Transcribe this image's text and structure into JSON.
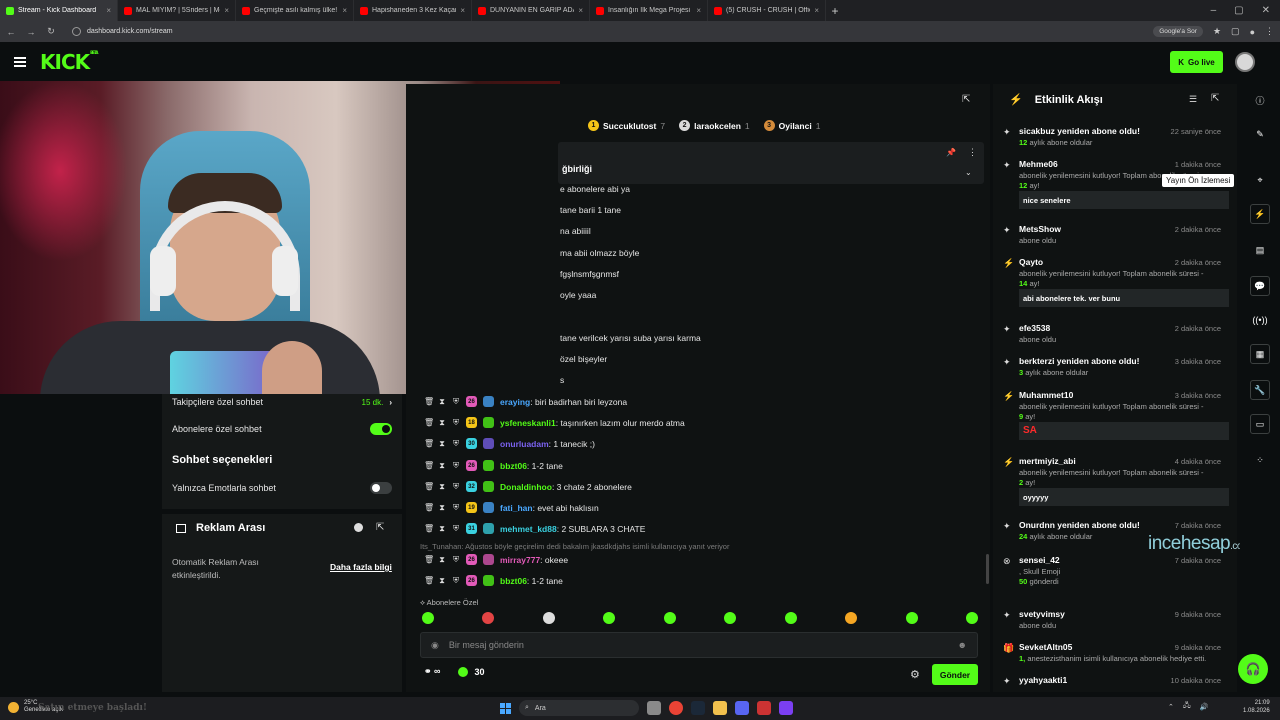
{
  "browser": {
    "tabs": [
      {
        "title": "Stream - Kick Dashboard",
        "active": true,
        "color": "#53fc18"
      },
      {
        "title": "MAL MIYIM? | 5Sriders | Motosi",
        "active": false,
        "color": "#ff0000"
      },
      {
        "title": "Geçmişte asılı kalmış ülke! Kübal",
        "active": false,
        "color": "#ff0000"
      },
      {
        "title": "Hapishaneden 3 Kez Kaçan Adam",
        "active": false,
        "color": "#ff0000"
      },
      {
        "title": "DÜNYANIN EN GARİP ADASINI",
        "active": false,
        "color": "#ff0000"
      },
      {
        "title": "İnsanlığın İlk Mega Projesi Göb",
        "active": false,
        "color": "#ff0000"
      },
      {
        "title": "(5) CRUSH - CRUSH | Official M",
        "active": false,
        "color": "#ff0000"
      }
    ],
    "url": "dashboard.kick.com/stream",
    "google_pill": "Google'a Sor"
  },
  "header": {
    "logo": "KICK",
    "logo_badge": "BETA",
    "go_live_label": "Go live"
  },
  "settings": {
    "follower_chat_label": "Takipçilere özel sohbet",
    "follower_chat_value": "15 dk.",
    "sub_chat_label": "Abonelere özel sohbet",
    "chat_options_title": "Sohbet seçenekleri",
    "emote_chat_label": "Yalnızca Emotlarla sohbet"
  },
  "ad_break": {
    "title": "Reklam Arası",
    "text": "Otomatik Reklam Arası etkinleştirildi.",
    "link": "Daha fazla bilgi"
  },
  "chat": {
    "top_gifters": [
      {
        "rank": "1",
        "name": "Succuklutost",
        "count": "7",
        "color": "#f5c518"
      },
      {
        "rank": "2",
        "name": "laraokcelen",
        "count": "1",
        "color": "#d9d9d9"
      },
      {
        "rank": "3",
        "name": "Oyilanci",
        "count": "1",
        "color": "#d48b3a"
      }
    ],
    "pinned_title": "ğbirliği",
    "hidden_messages": [
      "e abonelere abi ya",
      "tane barii 1 tane",
      "na abiiiil",
      "ma abii olmazz böyle",
      "fgşlnsmfşgnmsf",
      "oyle yaaa",
      "tane verilcek yarısı suba yarısı karma",
      "özel bişeyler",
      "s"
    ],
    "messages": [
      {
        "badge": "26",
        "badge_color": "#e25ab8",
        "user": "eraying",
        "user_color": "#4aa8ff",
        "text": "biri badirhan biri leyzona"
      },
      {
        "badge": "18",
        "badge_color": "#f5c518",
        "user": "ysfeneskanli1",
        "user_color": "#53fc18",
        "text": "taşınırken lazım olur merdo atma"
      },
      {
        "badge": "30",
        "badge_color": "#3ad1e0",
        "user": "onurluadam",
        "user_color": "#7b62f0",
        "text": "1 tanecik ;)"
      },
      {
        "badge": "26",
        "badge_color": "#e25ab8",
        "user": "bbzt06",
        "user_color": "#53fc18",
        "text": "1-2 tane"
      },
      {
        "badge": "32",
        "badge_color": "#3ad1e0",
        "user": "Donaldinhoo",
        "user_color": "#53fc18",
        "text": "3 chate 2 abonelere"
      },
      {
        "badge": "19",
        "badge_color": "#f5c518",
        "user": "fati_han",
        "user_color": "#4aa8ff",
        "text": "evet abi haklısın"
      },
      {
        "badge": "31",
        "badge_color": "#3ad1e0",
        "user": "mehmet_kd88",
        "user_color": "#3ad1e0",
        "text": "2 SUBLARA 3 CHATE"
      },
      {
        "badge": "26",
        "badge_color": "#e25ab8",
        "user": "mirray777",
        "user_color": "#e25ab8",
        "text": "okeee"
      },
      {
        "badge": "26",
        "badge_color": "#e25ab8",
        "user": "bbzt06",
        "user_color": "#53fc18",
        "text": "1-2 tane"
      }
    ],
    "reply_hint": "Its_Tunahan: Ağustos böyle geçirelim dedi bakalım jkasdkdjahs isimli kullanıcıya yanıt veriyor",
    "sub_only_label": "Abonelere Özel",
    "input_placeholder": "Bir mesaj gönderin",
    "points": "30",
    "send_label": "Gönder"
  },
  "feed": {
    "title": "Etkinlik Akışı",
    "tooltip": "Yayın Ön İzlemesi",
    "items": [
      {
        "name": "sicakbuz yeniden abone oldu!",
        "time": "22 saniye önce",
        "sub_num": "12",
        "sub_text": "aylık abone oldular"
      },
      {
        "name": "Mehme06",
        "time": "1 dakika önce",
        "sub_text": "abonelik yenilemesini kutluyor! Toplam abonelik süresi -",
        "sub_num2": "12",
        "sub_text2": "ay!",
        "msg": "nice senelere"
      },
      {
        "name": "MetsShow",
        "time": "2 dakika önce",
        "sub_text": "abone oldu"
      },
      {
        "name": "Qayto",
        "time": "2 dakika önce",
        "sub_text": "abonelik yenilemesini kutluyor! Toplam abonelik süresi -",
        "sub_num2": "14",
        "sub_text2": "ay!",
        "msg": "abi abonelere tek. ver bunu"
      },
      {
        "name": "efe3538",
        "time": "2 dakika önce",
        "sub_text": "abone oldu"
      },
      {
        "name": "berkterzi yeniden abone oldu!",
        "time": "3 dakika önce",
        "sub_num": "3",
        "sub_text": "aylık abone oldular"
      },
      {
        "name": "Muhammet10",
        "time": "3 dakika önce",
        "sub_text": "abonelik yenilemesini kutluyor! Toplam abonelik süresi -",
        "sub_num2": "9",
        "sub_text2": "ay!",
        "msg": "SA"
      },
      {
        "name": "mertmiyiz_abi",
        "time": "4 dakika önce",
        "sub_text": "abonelik yenilemesini kutluyor! Toplam abonelik süresi -",
        "sub_num2": "2",
        "sub_text2": "ay!",
        "msg": "oyyyyy"
      },
      {
        "name": "Onurdnn yeniden abone oldu!",
        "time": "7 dakika önce",
        "sub_num": "24",
        "sub_text": "aylık abone oldular"
      },
      {
        "name": "sensei_42",
        "time": "7 dakika önce",
        "sub_text": ", Skull Emoji",
        "sub_num2": "50",
        "sub_text2": "gönderdi"
      },
      {
        "name": "svetyvimsy",
        "time": "9 dakika önce",
        "sub_text": "abone oldu"
      },
      {
        "name": "SevketAltn05",
        "time": "9 dakika önce",
        "sub_num": "1,",
        "sub_text": "anestezisthanim isimli kullanıcıya abonelik hediye etti."
      },
      {
        "name": "yyahyaakti1",
        "time": "10 dakika önce"
      }
    ]
  },
  "watermark": {
    "main": "incehesap",
    "suffix": ".com"
  },
  "taskbar": {
    "temp": "25°C",
    "weather": "Genellikle açık",
    "ghost_text": "Satın etmeye başladı!",
    "search": "Ara",
    "time": "21:09",
    "date": "1.08.2026"
  }
}
